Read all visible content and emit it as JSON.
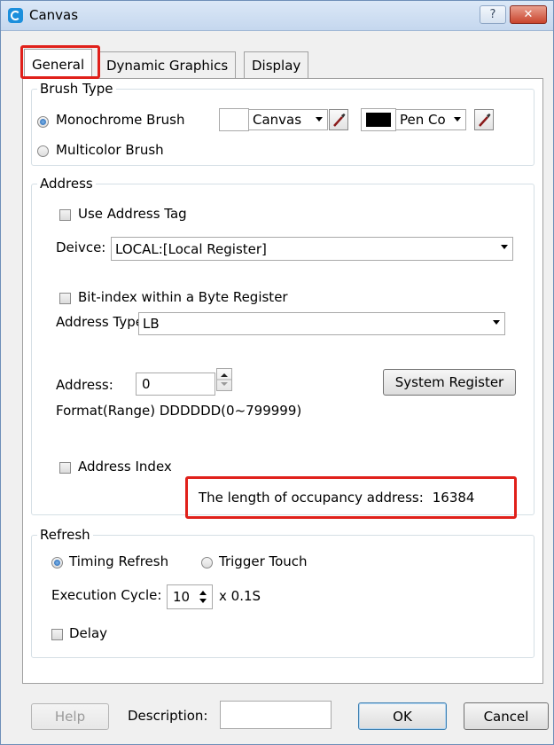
{
  "window": {
    "title": "Canvas",
    "help_glyph": "?",
    "close_glyph": "✕"
  },
  "tabs": [
    {
      "label": "General",
      "active": true
    },
    {
      "label": "Dynamic Graphics"
    },
    {
      "label": "Display"
    }
  ],
  "brush_type": {
    "legend": "Brush Type",
    "monochrome_label": "Monochrome Brush",
    "multicolor_label": "Multicolor Brush",
    "canvas_color_label": "Canvas",
    "canvas_color": "#ffffff",
    "pen_color_label": "Pen Co",
    "pen_color": "#000000"
  },
  "address": {
    "legend": "Address",
    "use_address_tag_label": "Use Address Tag",
    "device_label": "Deivce:",
    "device_value": "LOCAL:[Local Register]",
    "bit_index_label": "Bit-index within a Byte Register",
    "address_type_label": "Address Type:",
    "address_type_value": "LB",
    "address_label": "Address:",
    "address_value": "0",
    "system_register_button": "System Register",
    "format_text": "Format(Range) DDDDDD(0~799999)",
    "address_index_label": "Address Index",
    "occupancy_label": "The length of occupancy address:",
    "occupancy_value": "16384"
  },
  "refresh": {
    "legend": "Refresh",
    "timing_label": "Timing Refresh",
    "trigger_label": "Trigger Touch",
    "execution_label": "Execution Cycle:",
    "execution_value": "10",
    "execution_unit": "x 0.1S",
    "delay_label": "Delay"
  },
  "footer": {
    "help_button": "Help",
    "description_label": "Description:",
    "description_value": "",
    "ok_button": "OK",
    "cancel_button": "Cancel"
  },
  "colors": {
    "highlight": "#e0201a",
    "accent": "#1d5fae"
  }
}
